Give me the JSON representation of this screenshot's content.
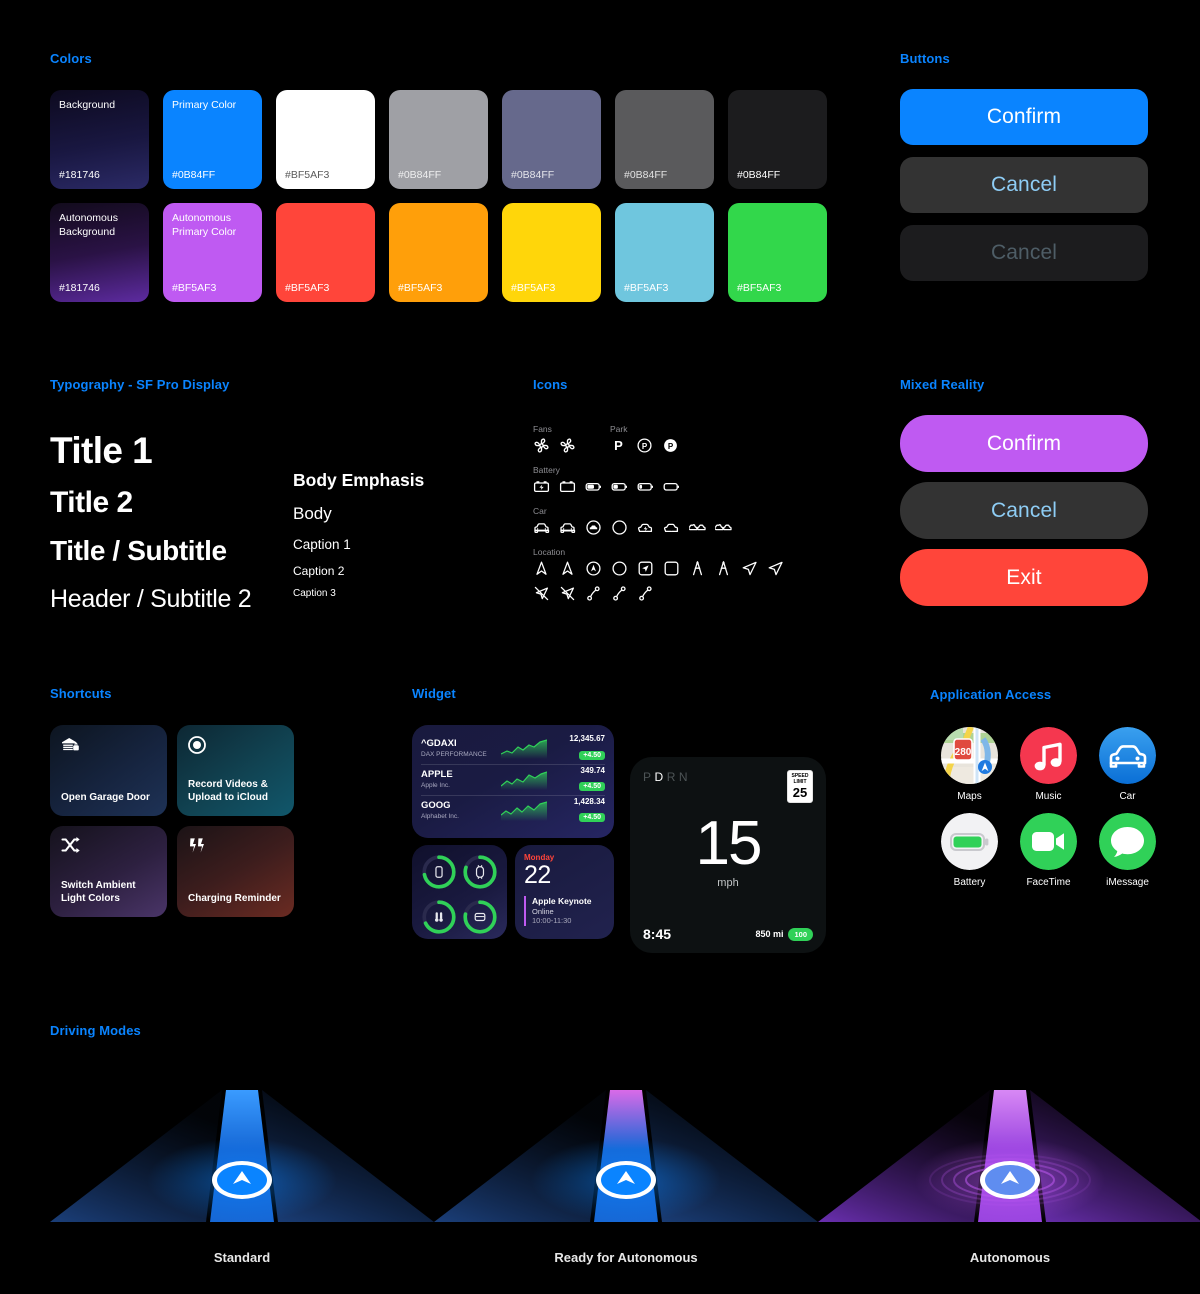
{
  "sections": {
    "colors": "Colors",
    "buttons": "Buttons",
    "typography": "Typography - SF Pro Display",
    "icons": "Icons",
    "mixed_reality": "Mixed Reality",
    "shortcuts": "Shortcuts",
    "widget": "Widget",
    "application_access": "Application Access",
    "driving_modes": "Driving Modes"
  },
  "colors": {
    "row1": [
      {
        "name": "Background",
        "hex": "#181746",
        "fill": "linear-gradient(170deg,#0d0a1f 0%,#191741 55%,#2b2a66 100%)",
        "text": "light"
      },
      {
        "name": "Primary Color",
        "hex": "#0B84FF",
        "fill": "#0A84FF",
        "text": "light"
      },
      {
        "name": "",
        "hex": "#BF5AF3",
        "fill": "#FFFFFF",
        "text": "dark"
      },
      {
        "name": "",
        "hex": "#0B84FF",
        "fill": "#9FA0A5",
        "text": "dim"
      },
      {
        "name": "",
        "hex": "#0B84FF",
        "fill": "#66698C",
        "text": "dim"
      },
      {
        "name": "",
        "hex": "#0B84FF",
        "fill": "#5A5A5C",
        "text": "dim"
      },
      {
        "name": "",
        "hex": "#0B84FF",
        "fill": "#1C1C1E",
        "text": "light"
      }
    ],
    "row2": [
      {
        "name": "Autonomous Background",
        "hex": "#181746",
        "fill": "linear-gradient(170deg,#120b1c 0%,#2a1245 50%,#5d2ba0 100%)",
        "text": "light"
      },
      {
        "name": "Autonomous Primary Color",
        "hex": "#BF5AF3",
        "fill": "#BF5AF2",
        "text": "light"
      },
      {
        "name": "",
        "hex": "#BF5AF3",
        "fill": "#FF453A",
        "text": "light"
      },
      {
        "name": "",
        "hex": "#BF5AF3",
        "fill": "#FF9F0A",
        "text": "light"
      },
      {
        "name": "",
        "hex": "#BF5AF3",
        "fill": "#FFD60A",
        "text": "light"
      },
      {
        "name": "",
        "hex": "#BF5AF3",
        "fill": "#6FC6DE",
        "text": "light"
      },
      {
        "name": "",
        "hex": "#BF5AF3",
        "fill": "#32D74B",
        "text": "light"
      }
    ]
  },
  "buttons": [
    {
      "label": "Confirm",
      "style": "primary"
    },
    {
      "label": "Cancel",
      "style": "secondary"
    },
    {
      "label": "Cancel",
      "style": "disabled"
    }
  ],
  "mixed_reality_buttons": [
    {
      "label": "Confirm",
      "style": "purple"
    },
    {
      "label": "Cancel",
      "style": "dark"
    },
    {
      "label": "Exit",
      "style": "red"
    }
  ],
  "typography": {
    "title1": "Title 1",
    "title2": "Title 2",
    "title_subtitle": "Title / Subtitle",
    "header_subtitle2": "Header / Subtitle 2",
    "body_emphasis": "Body Emphasis",
    "body": "Body",
    "caption1": "Caption 1",
    "caption2": "Caption 2",
    "caption3": "Caption 3"
  },
  "icons": {
    "groups": [
      {
        "label": "Fans",
        "items": [
          "fan-blades-icon",
          "fan-clover-icon"
        ]
      },
      {
        "label": "Park",
        "items": [
          "park-p-icon",
          "park-p-circle-icon",
          "park-p-circle-fill-icon"
        ]
      },
      {
        "label": "Battery",
        "items": [
          "battery-block-bolt-icon",
          "battery-block-bolt-fill-icon",
          "battery-75-icon",
          "battery-50-icon",
          "battery-25-icon",
          "battery-empty-icon"
        ]
      },
      {
        "label": "Car",
        "items": [
          "car-icon",
          "car-front-icon",
          "car-circle-icon",
          "car-circle-fill-icon",
          "car-bolt-icon",
          "car-bolt-fill-icon",
          "car-two-icon",
          "car-two-fill-icon"
        ]
      },
      {
        "label": "Location",
        "items": [
          "location-north-icon",
          "location-north-fill-icon",
          "location-circle-icon",
          "location-circle-fill-icon",
          "location-square-icon",
          "location-square-fill-icon",
          "location-pin-icon",
          "location-pin-fill-icon",
          "location-arrow-icon",
          "location-arrow-fill-icon",
          "location-slash-icon",
          "location-slash-fill-icon",
          "route-icon",
          "route-fill-icon",
          "route-alt-icon"
        ]
      }
    ],
    "park_labels": [
      "P",
      "P",
      "P"
    ]
  },
  "shortcuts": [
    {
      "label": "Open Garage Door",
      "icon": "garage-lock-icon",
      "theme": "sc-1"
    },
    {
      "label": "Record Videos & Upload to iCloud",
      "icon": "record-icon",
      "theme": "sc-2"
    },
    {
      "label": "Switch Ambient Light Colors",
      "icon": "shuffle-icon",
      "theme": "sc-3"
    },
    {
      "label": "Charging Reminder",
      "icon": "bolt-badge-icon",
      "theme": "sc-4"
    }
  ],
  "widget": {
    "stocks": [
      {
        "symbol": "^GDAXI",
        "name": "DAX PERFORMANCE",
        "price": "12,345.67",
        "change": "+4.50"
      },
      {
        "symbol": "APPLE",
        "name": "Apple Inc.",
        "price": "349.74",
        "change": "+4.50"
      },
      {
        "symbol": "GOOG",
        "name": "Alphabet Inc.",
        "price": "1,428.34",
        "change": "+4.50"
      }
    ],
    "rings": [
      "iphone-battery-ring",
      "watch-battery-ring",
      "airpods-battery-ring",
      "airpods-case-battery-ring"
    ],
    "calendar": {
      "day": "Monday",
      "date": "22",
      "event_title": "Apple Keynote",
      "event_location": "Online",
      "event_time": "10:00-11:30"
    },
    "dashboard": {
      "gear_letters": [
        "P",
        "D",
        "R",
        "N"
      ],
      "gear_active": "D",
      "speed_limit_label": "SPEED LIMIT",
      "speed_limit": "25",
      "speed": "15",
      "speed_unit": "mph",
      "time": "8:45",
      "range": "850 mi",
      "battery": "100"
    }
  },
  "apps": [
    {
      "label": "Maps",
      "icon": "maps-icon",
      "badge": "280"
    },
    {
      "label": "Music",
      "icon": "music-icon"
    },
    {
      "label": "Car",
      "icon": "car-app-icon"
    },
    {
      "label": "Battery",
      "icon": "battery-app-icon"
    },
    {
      "label": "FaceTime",
      "icon": "facetime-icon"
    },
    {
      "label": "iMessage",
      "icon": "imessage-icon"
    }
  ],
  "driving_modes": [
    {
      "label": "Standard",
      "mode": "standard"
    },
    {
      "label": "Ready for Autonomous",
      "mode": "ready"
    },
    {
      "label": "Autonomous",
      "mode": "autonomous"
    }
  ],
  "accent": "#0A84FF"
}
